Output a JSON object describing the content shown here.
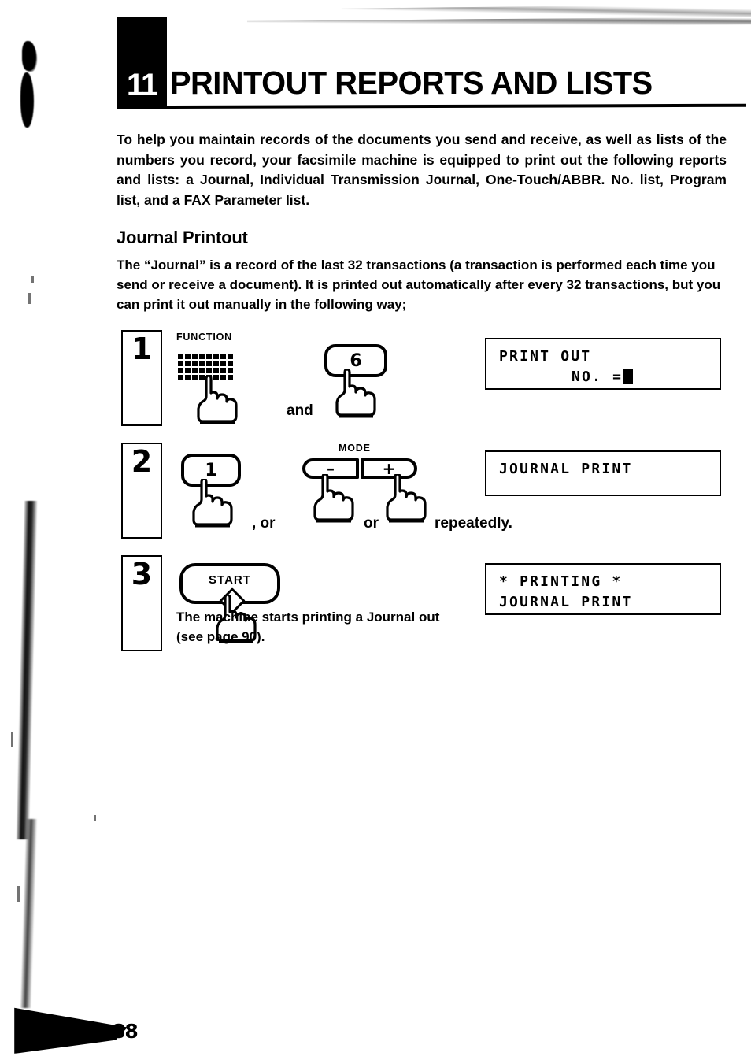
{
  "document": {
    "chapter_number": "11",
    "chapter_title": "PRINTOUT REPORTS AND LISTS",
    "page_number": "88"
  },
  "intro_paragraph": "To help you maintain records of the documents you send and receive, as well as lists of the numbers you record, your facsimile machine is equipped to print out the following reports and lists: a Journal, Individual Transmission Journal, One-Touch/ABBR. No. list, Program list, and a FAX Parameter list.",
  "section": {
    "heading": "Journal Printout",
    "body": "The “Journal” is a record of the last 32 transactions (a transaction is performed each time you send or receive a document). It is printed out automatically after every 32 transactions, but you can print it out manually in the following way;"
  },
  "steps": [
    {
      "number": "1",
      "function_label": "FUNCTION",
      "key_6": "6",
      "conjunction": "and",
      "display": {
        "line1": "PRINT OUT",
        "line2": "NO. =",
        "has_cursor": true
      }
    },
    {
      "number": "2",
      "key_1": "1",
      "mode_label": "MODE",
      "mode_minus": "–",
      "mode_plus": "+",
      "text_after_key1": ", or",
      "text_between_modes": "or",
      "text_end": "repeatedly.",
      "display": {
        "line1": "JOURNAL PRINT",
        "line2": "",
        "has_cursor": false
      }
    },
    {
      "number": "3",
      "start_label": "START",
      "display": {
        "line1": "* PRINTING *",
        "line2": "JOURNAL PRINT",
        "has_cursor": false
      }
    }
  ],
  "closing_note": {
    "line1": "The machine starts printing a Journal out",
    "line2": "(see page 90)."
  }
}
